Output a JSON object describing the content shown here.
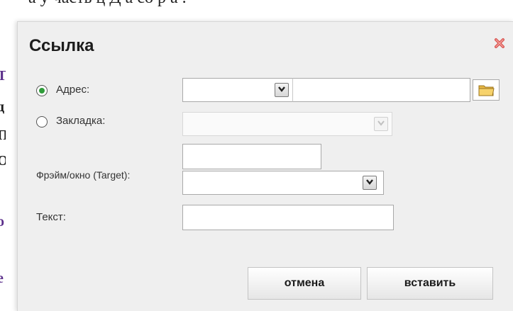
{
  "background": {
    "top_text": "а       у часть ц  Д  а со  р  а     .",
    "side_chars": [
      "Т",
      "д",
      "П",
      "О",
      "о",
      "е"
    ]
  },
  "dialog": {
    "title": "Ссылка",
    "close_icon": "close-x-icon",
    "address": {
      "label": "Адрес:",
      "selected": true,
      "protocol_value": "",
      "url_value": ""
    },
    "bookmark": {
      "label": "Закладка:",
      "selected": false,
      "value": ""
    },
    "target": {
      "label": "Фрэйм/окно (Target):",
      "name_value": "",
      "select_value": ""
    },
    "text": {
      "label": "Текст:",
      "value": ""
    },
    "buttons": {
      "cancel": "отмена",
      "insert": "вставить"
    }
  }
}
